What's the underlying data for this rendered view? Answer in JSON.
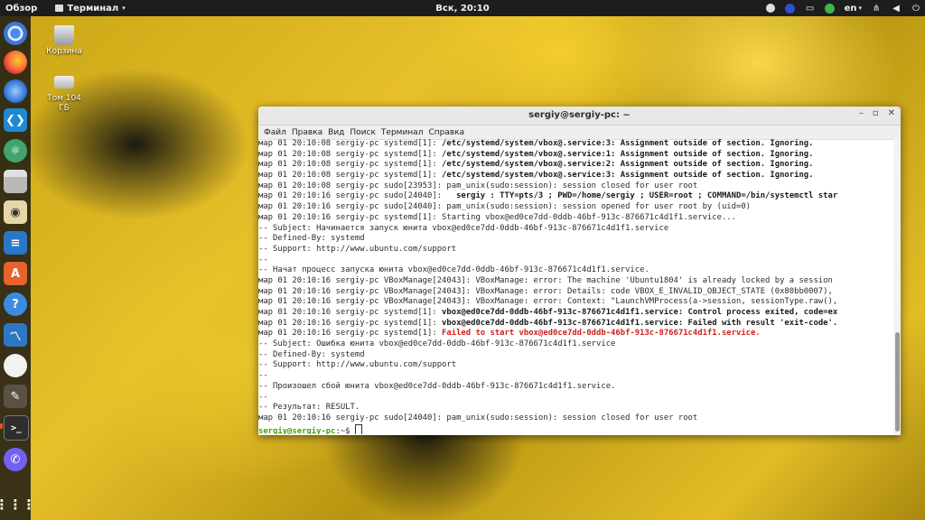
{
  "topbar": {
    "overview": "Обзор",
    "app_menu": "Терминал",
    "clock": "Вск, 20:10",
    "language": "en"
  },
  "desktop": {
    "trash_label": "Корзина",
    "volume_label": "Том 104 ГБ"
  },
  "dock": {
    "apps": [
      "chromium-icon",
      "firefox-icon",
      "thunderbird-icon",
      "vscode-icon",
      "atom-icon",
      "files-icon",
      "rhythmbox-icon",
      "writer-icon",
      "appcenter-icon",
      "help-icon",
      "monitor-icon",
      "egg-icon",
      "gimp-icon",
      "terminal-icon",
      "viber-icon",
      "apps-grid-icon"
    ]
  },
  "terminal": {
    "title": "sergiy@sergiy-pc: ~",
    "menu": [
      "Файл",
      "Правка",
      "Вид",
      "Поиск",
      "Терминал",
      "Справка"
    ],
    "lines": [
      {
        "prefix": "мар 01 20:10:08 sergiy-pc systemd[1]: ",
        "text": "/etc/systemd/system/vbox@.service:3: Assignment outside of section. Ignoring.",
        "style": "b"
      },
      {
        "prefix": "мар 01 20:10:08 sergiy-pc systemd[1]: ",
        "text": "/etc/systemd/system/vbox@.service:1: Assignment outside of section. Ignoring.",
        "style": "b"
      },
      {
        "prefix": "мар 01 20:10:08 sergiy-pc systemd[1]: ",
        "text": "/etc/systemd/system/vbox@.service:2: Assignment outside of section. Ignoring.",
        "style": "b"
      },
      {
        "prefix": "мар 01 20:10:08 sergiy-pc systemd[1]: ",
        "text": "/etc/systemd/system/vbox@.service:3: Assignment outside of section. Ignoring.",
        "style": "b"
      },
      {
        "prefix": "мар 01 20:10:08 sergiy-pc sudo[23953]: pam_unix(sudo:session): session closed for user root",
        "text": "",
        "style": ""
      },
      {
        "prefix": "мар 01 20:10:16 sergiy-pc sudo[24040]:   ",
        "text": "sergiy : TTY=pts/3 ; PWD=/home/sergiy ; USER=root ; COMMAND=/bin/systemctl star",
        "style": "b"
      },
      {
        "prefix": "мар 01 20:10:16 sergiy-pc sudo[24040]: pam_unix(sudo:session): session opened for user root by (uid=0)",
        "text": "",
        "style": ""
      },
      {
        "prefix": "мар 01 20:10:16 sergiy-pc systemd[1]: Starting vbox@ed0ce7dd-0ddb-46bf-913c-876671c4d1f1.service...",
        "text": "",
        "style": ""
      },
      {
        "prefix": "-- Subject: Начинается запуск юнита vbox@ed0ce7dd-0ddb-46bf-913c-876671c4d1f1.service",
        "text": "",
        "style": ""
      },
      {
        "prefix": "-- Defined-By: systemd",
        "text": "",
        "style": ""
      },
      {
        "prefix": "-- Support: http://www.ubuntu.com/support",
        "text": "",
        "style": ""
      },
      {
        "prefix": "--",
        "text": "",
        "style": ""
      },
      {
        "prefix": "-- Начат процесс запуска юнита vbox@ed0ce7dd-0ddb-46bf-913c-876671c4d1f1.service.",
        "text": "",
        "style": ""
      },
      {
        "prefix": "мар 01 20:10:16 sergiy-pc VBoxManage[24043]: VBoxManage: error: The machine 'Ubuntu1804' is already locked by a session",
        "text": "",
        "style": ""
      },
      {
        "prefix": "мар 01 20:10:16 sergiy-pc VBoxManage[24043]: VBoxManage: error: Details: code VBOX_E_INVALID_OBJECT_STATE (0x80bb0007),",
        "text": "",
        "style": ""
      },
      {
        "prefix": "мар 01 20:10:16 sergiy-pc VBoxManage[24043]: VBoxManage: error: Context: \"LaunchVMProcess(a->session, sessionType.raw(),",
        "text": "",
        "style": ""
      },
      {
        "prefix": "мар 01 20:10:16 sergiy-pc systemd[1]: ",
        "text": "vbox@ed0ce7dd-0ddb-46bf-913c-876671c4d1f1.service: Control process exited, code=ex",
        "style": "b"
      },
      {
        "prefix": "мар 01 20:10:16 sergiy-pc systemd[1]: ",
        "text": "vbox@ed0ce7dd-0ddb-46bf-913c-876671c4d1f1.service: Failed with result 'exit-code'.",
        "style": "b"
      },
      {
        "prefix": "мар 01 20:10:16 sergiy-pc systemd[1]: ",
        "text": "Failed to start vbox@ed0ce7dd-0ddb-46bf-913c-876671c4d1f1.service.",
        "style": "err"
      },
      {
        "prefix": "-- Subject: Ошибка юнита vbox@ed0ce7dd-0ddb-46bf-913c-876671c4d1f1.service",
        "text": "",
        "style": ""
      },
      {
        "prefix": "-- Defined-By: systemd",
        "text": "",
        "style": ""
      },
      {
        "prefix": "-- Support: http://www.ubuntu.com/support",
        "text": "",
        "style": ""
      },
      {
        "prefix": "--",
        "text": "",
        "style": ""
      },
      {
        "prefix": "-- Произошел сбой юнита vbox@ed0ce7dd-0ddb-46bf-913c-876671c4d1f1.service.",
        "text": "",
        "style": ""
      },
      {
        "prefix": "--",
        "text": "",
        "style": ""
      },
      {
        "prefix": "-- Результат: RESULT.",
        "text": "",
        "style": ""
      },
      {
        "prefix": "мар 01 20:10:16 sergiy-pc sudo[24040]: pam_unix(sudo:session): session closed for user root",
        "text": "",
        "style": ""
      }
    ],
    "prompt_user": "sergiy@sergiy-pc",
    "prompt_path": ":~$ "
  }
}
